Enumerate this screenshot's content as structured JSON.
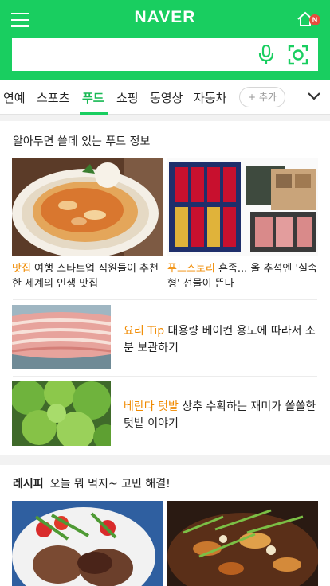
{
  "header": {
    "logo": "NAVER",
    "home_badge": "N",
    "search_placeholder": ""
  },
  "tabs": [
    {
      "label": "연예"
    },
    {
      "label": "스포츠"
    },
    {
      "label": "푸드"
    },
    {
      "label": "쇼핑"
    },
    {
      "label": "동영상"
    },
    {
      "label": "자동차"
    }
  ],
  "add_tab_label": "+ 추가",
  "food_section": {
    "title": "알아두면 쓸데 있는 푸드 정보",
    "featured": [
      {
        "category": "맛집",
        "text": " 여행 스타트업 직원들이 추천한 세계의 인생 맛집",
        "image": "pizza-photo"
      },
      {
        "category": "푸드스토리",
        "text": " 혼족... 올 추석엔 '실속형' 선물이 뜬다",
        "image": "gift-set-photo"
      }
    ],
    "list": [
      {
        "category": "요리 Tip",
        "text": " 대용량 베이컨 용도에 따라서 소분 보관하기",
        "image": "bacon-photo"
      },
      {
        "category": "베란다 텃밭",
        "text": " 상추 수확하는 재미가 쏠쏠한 텃밭 이야기",
        "image": "lettuce-photo"
      }
    ]
  },
  "recipe_section": {
    "label": "레시피",
    "title": "오늘 뭐 먹지~ 고민 해결!",
    "images": [
      "hamburg-steak-photo",
      "stir-fry-photo"
    ]
  },
  "colors": {
    "brand_green": "#19ce60",
    "active_tab": "#19b955",
    "category_orange": "#f08a00",
    "badge_red": "#e64c3c"
  }
}
